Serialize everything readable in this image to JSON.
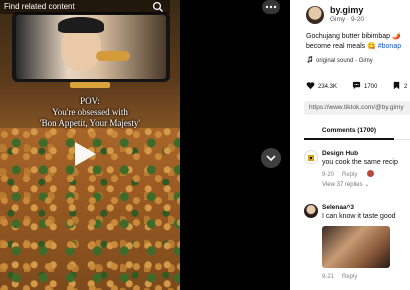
{
  "video": {
    "search_placeholder": "Find related content",
    "caption_line1": "POV:",
    "caption_line2": "You're obsessed with",
    "caption_line3": "'Bon Appetit, Your Majesty'"
  },
  "author": {
    "name": "by.gimy",
    "sub": "Gimy · 9-20"
  },
  "description": {
    "line1": "Gochujang butter bibimbap 🌶️",
    "line2_text": "become real meals 😋 ",
    "line2_tag": "#bonap"
  },
  "sound": "original sound - Gimy",
  "stats": {
    "likes": "234.3K",
    "comments": "1700",
    "bookmarks": "2"
  },
  "share_link": "https://www.tiktok.com/@by.gimy",
  "tabs": {
    "comments_label": "Comments (1700)"
  },
  "comments": [
    {
      "name": "Design Hub",
      "text": "you cook the same recip",
      "date": "9-20",
      "reply": "Reply",
      "replies": "View 37 replies ⌄"
    },
    {
      "name": "Selenaa^3",
      "text": "I can know it taste good",
      "date": "9-21",
      "reply": "Reply"
    }
  ],
  "colors": {
    "hashtag": "#1a55c8",
    "like": "#111111"
  }
}
